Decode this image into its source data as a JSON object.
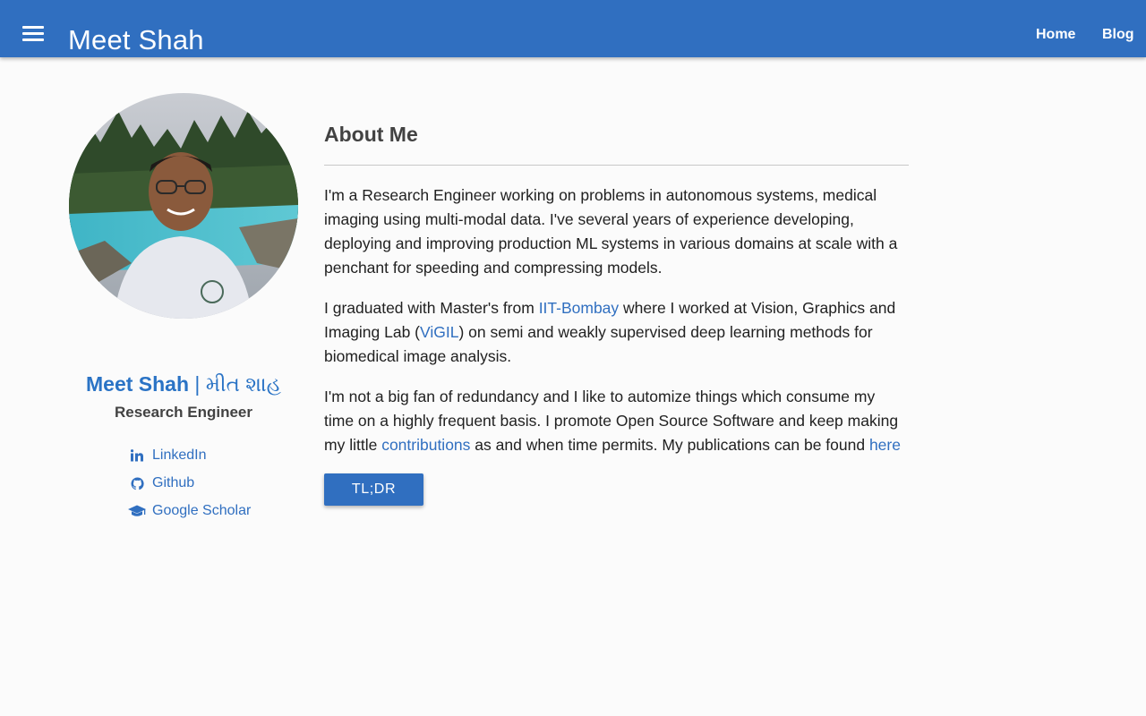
{
  "header": {
    "site_title": "Meet Shah",
    "nav": [
      {
        "label": "Home"
      },
      {
        "label": "Blog"
      }
    ],
    "menu_icon": "hamburger-menu-icon"
  },
  "sidebar": {
    "avatar_alt": "profile photo",
    "name_en": "Meet Shah",
    "separator": "|",
    "name_gu": "મીત શાહ",
    "role": "Research Engineer",
    "links": [
      {
        "label": "LinkedIn",
        "icon": "linkedin-icon"
      },
      {
        "label": "Github",
        "icon": "github-icon"
      },
      {
        "label": "Google Scholar",
        "icon": "graduation-cap-icon"
      }
    ]
  },
  "main": {
    "title": "About Me",
    "p1": "I'm a Research Engineer working on problems in autonomous systems, medical imaging using multi-modal data. I've several years of experience developing, deploying and improving production ML systems in various domains at scale with a penchant for speeding and compressing models.",
    "p2": {
      "t1": "I graduated with Master's from ",
      "link1": "IIT-Bombay",
      "t2": " where I worked at Vision, Graphics and Imaging Lab (",
      "link2": "ViGIL",
      "t3": ") on semi and weakly supervised deep learning methods for biomedical image analysis."
    },
    "p3": {
      "t1": "I'm not a big fan of redundancy and I like to automize things which consume my time on a highly frequent basis. I promote Open Source Software and keep making my little ",
      "link1": "contributions",
      "t2": " as and when time permits. My publications can be found ",
      "link2": "here"
    },
    "tldr_label": "TL;DR"
  },
  "colors": {
    "header_bg": "#306fc0",
    "link": "#306fc0",
    "name": "#2a73c5",
    "text": "#212121",
    "heading": "#424242",
    "page_bg": "#fbfbfb"
  }
}
